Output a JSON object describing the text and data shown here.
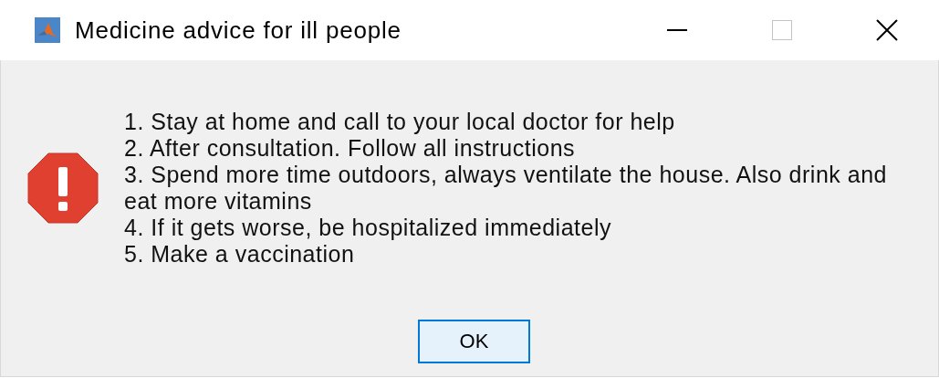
{
  "window": {
    "title": "Medicine advice for ill people",
    "title_buttons": [
      {
        "kind": "minimize",
        "disabled": false
      },
      {
        "kind": "maximize",
        "disabled": true
      },
      {
        "kind": "close",
        "disabled": false
      }
    ]
  },
  "message": {
    "kind": "error",
    "lines": [
      "1. Stay at home and call to your local doctor for help",
      "2. After consultation. Follow all instructions",
      "3. Spend more time outdoors, always ventilate the house. Also drink and eat more vitamins",
      "4. If it gets worse, be hospitalized immediately",
      "5. Make a vaccination"
    ]
  },
  "buttons": [
    "OK"
  ]
}
